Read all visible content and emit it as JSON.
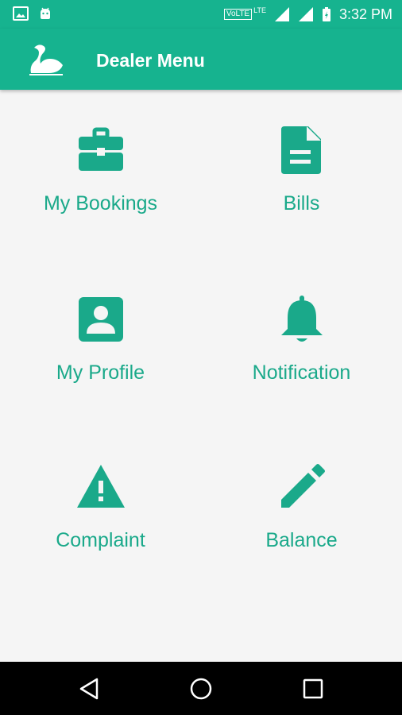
{
  "status_bar": {
    "time": "3:32 PM",
    "network_badge": "VoLTE",
    "network_type": "LTE",
    "icons": [
      "image-icon",
      "android-icon",
      "signal-icon",
      "signal-icon",
      "battery-charging-icon"
    ]
  },
  "app_bar": {
    "title": "Dealer Menu",
    "logo": "swan-logo-icon",
    "color": "#16b38f"
  },
  "menu": {
    "accent_color": "#1aa98a",
    "items": [
      {
        "label": "My Bookings",
        "icon": "briefcase-icon"
      },
      {
        "label": "Bills",
        "icon": "document-icon"
      },
      {
        "label": "My Profile",
        "icon": "profile-card-icon"
      },
      {
        "label": "Notification",
        "icon": "bell-icon"
      },
      {
        "label": "Complaint",
        "icon": "warning-icon"
      },
      {
        "label": "Balance",
        "icon": "pencil-icon"
      }
    ]
  },
  "nav_bar": {
    "buttons": [
      "back-icon",
      "home-icon",
      "recents-icon"
    ]
  }
}
